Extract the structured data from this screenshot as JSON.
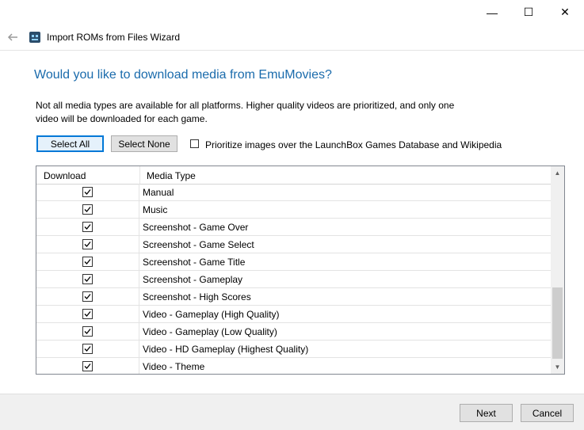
{
  "window": {
    "title": "Import ROMs from Files Wizard",
    "controls": {
      "minimize": "—",
      "maximize": "☐",
      "close": "✕"
    }
  },
  "heading": "Would you like to download media from EmuMovies?",
  "description": "Not all media types are available for all platforms. Higher quality videos are prioritized, and only one video will be downloaded for each game.",
  "buttons": {
    "select_all": "Select All",
    "select_none": "Select None",
    "next": "Next",
    "cancel": "Cancel"
  },
  "prioritize": {
    "label": "Prioritize images over the LaunchBox Games Database and Wikipedia",
    "checked": false
  },
  "grid": {
    "columns": [
      "Download",
      "Media Type"
    ],
    "rows": [
      {
        "checked": true,
        "media_type": "Manual"
      },
      {
        "checked": true,
        "media_type": "Music"
      },
      {
        "checked": true,
        "media_type": "Screenshot - Game Over"
      },
      {
        "checked": true,
        "media_type": "Screenshot - Game Select"
      },
      {
        "checked": true,
        "media_type": "Screenshot - Game Title"
      },
      {
        "checked": true,
        "media_type": "Screenshot - Gameplay"
      },
      {
        "checked": true,
        "media_type": "Screenshot - High Scores"
      },
      {
        "checked": true,
        "media_type": "Video - Gameplay (High Quality)"
      },
      {
        "checked": true,
        "media_type": "Video - Gameplay (Low Quality)"
      },
      {
        "checked": true,
        "media_type": "Video - HD Gameplay (Highest Quality)"
      },
      {
        "checked": true,
        "media_type": "Video - Theme"
      }
    ]
  },
  "colors": {
    "heading": "#1a6bac",
    "focus_border": "#0078d7"
  }
}
